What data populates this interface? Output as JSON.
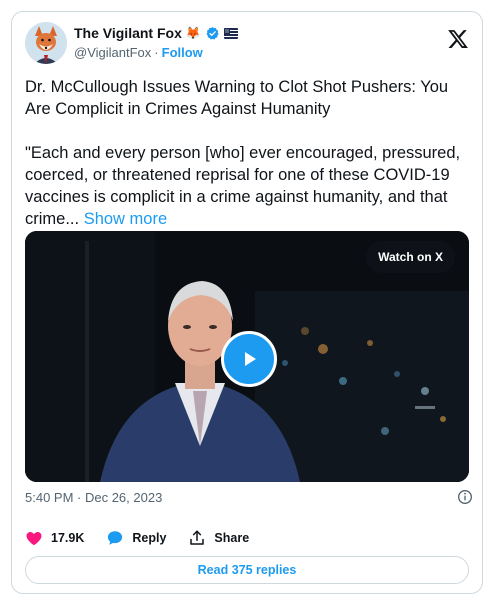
{
  "author": {
    "display_name": "The Vigilant Fox",
    "emoji": "🦊",
    "handle": "@VigilantFox",
    "separator": "·",
    "follow_label": "Follow"
  },
  "tweet": {
    "headline": "Dr. McCullough Issues Warning to Clot Shot Pushers: You Are Complicit in Crimes Against Humanity",
    "body": "\"Each and every person [who] ever encouraged, pressured, coerced, or threatened reprisal for one of these COVID-19 vaccines is complicit in a crime against humanity, and that crime...",
    "show_more_label": "Show more"
  },
  "video": {
    "watch_label": "Watch on X"
  },
  "meta": {
    "timestamp": "5:40 PM · Dec 26, 2023"
  },
  "actions": {
    "like_count": "17.9K",
    "reply_label": "Reply",
    "share_label": "Share"
  },
  "footer": {
    "read_replies_label": "Read 375 replies"
  },
  "colors": {
    "accent": "#1d9bf0",
    "like": "#f91880",
    "verified": "#1d9bf0",
    "muted_text": "#536471",
    "border": "#cfd9de"
  },
  "icons": [
    "avatar-fox",
    "verified-icon",
    "flag-icon",
    "x-logo-icon",
    "play-icon",
    "info-icon",
    "heart-icon",
    "reply-icon",
    "share-icon"
  ]
}
